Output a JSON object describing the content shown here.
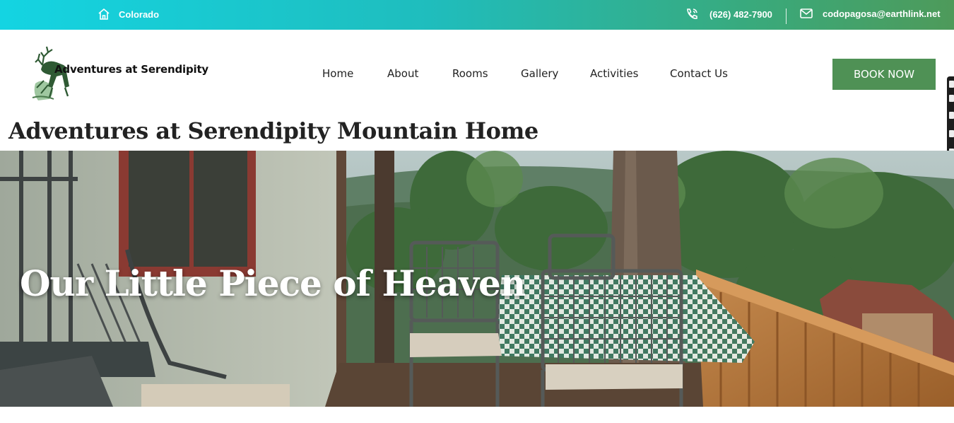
{
  "topbar": {
    "location": "Colorado",
    "phone": "(626) 482-7900",
    "email": "codopagosa@earthlink.net",
    "icons": [
      "home-icon",
      "phone-icon",
      "mail-icon"
    ]
  },
  "header": {
    "logo_text": "Adventures at Serendipity",
    "nav": [
      "Home",
      "About",
      "Rooms",
      "Gallery",
      "Activities",
      "Contact Us"
    ],
    "book_button": "BOOK NOW"
  },
  "page": {
    "title": "Adventures at Serendipity Mountain Home"
  },
  "hero": {
    "heading": "Our Little Piece of Heaven"
  },
  "colors": {
    "topbar_start": "#14d4e2",
    "topbar_end": "#4e9a5a",
    "button": "#4f9155"
  }
}
